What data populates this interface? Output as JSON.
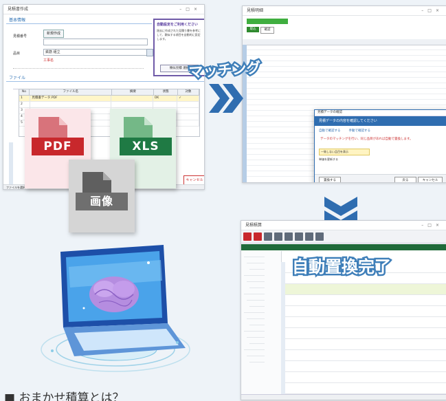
{
  "left_window": {
    "title": "見積書作成",
    "section1": "基本情報",
    "row_label1": "見積番号",
    "button1": "新規作成",
    "row_label2": "品目",
    "row_value2": "鉄筋 組立",
    "note1": "工事名",
    "tooltip": {
      "header": "自動設定をご利用ください",
      "body": "過去に作成された見積り書を参考にして、類似する項目を自動的に設定します。",
      "button": "類似見積 選択"
    },
    "section2": "ファイル",
    "table_header": [
      "No",
      "ファイル名",
      "摘要",
      "状態",
      "対象"
    ],
    "table_rows": [
      [
        "1",
        "見積書データ.PDF",
        "",
        "OK",
        "✓"
      ],
      [
        "2",
        "",
        "",
        "",
        ""
      ],
      [
        "3",
        "",
        "",
        "",
        ""
      ],
      [
        "4",
        "",
        "",
        "",
        ""
      ],
      [
        "5",
        "",
        "",
        "",
        ""
      ]
    ],
    "cancel_button": "キャンセル",
    "status": "ファイルを選択"
  },
  "file_icons": {
    "pdf": "PDF",
    "xls": "XLS",
    "image": "画像"
  },
  "right_top_window": {
    "title": "見積明細",
    "tabs": [
      "取込",
      "確認"
    ],
    "dialog": {
      "title": "見積データの確認",
      "header": "見積データの内容を確認してください",
      "option1": "自動で確認する",
      "option2": "手動で確認する",
      "message": "データのマッチングを行い、同じ品目があれば自動で置換します。",
      "check1": "一致しない品目を表示",
      "check2": "単価を更新する",
      "buttons": [
        "戻る",
        "置換する",
        "キャンセル"
      ]
    }
  },
  "overlays": {
    "matching": "マッチング",
    "complete": "自動置換完了"
  },
  "bottom_window": {
    "title": "見積積算"
  },
  "footer_heading": "■ おまかせ積算とは？",
  "colors": {
    "accent": "#2f6db0",
    "pdf_red": "#c8282c",
    "xls_green": "#1f7a44",
    "image_gray": "#6f6f6f",
    "overlay_outline": "#3f7fb9"
  }
}
